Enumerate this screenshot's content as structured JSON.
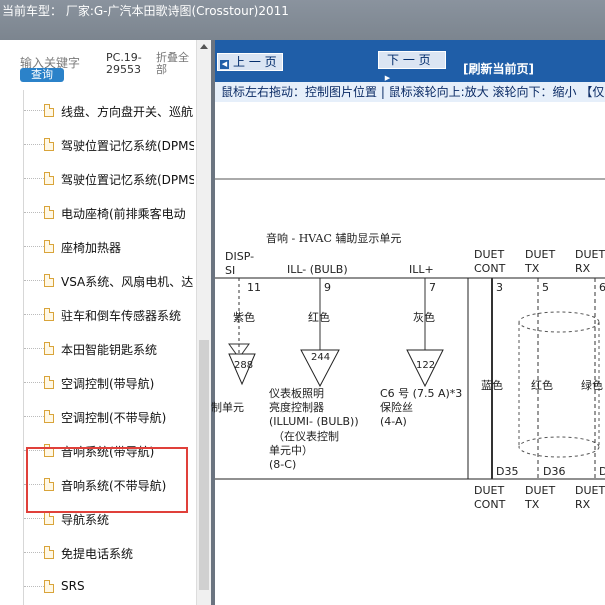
{
  "window": {
    "title": "当前车型：  厂家:G-广汽本田歌诗图(Crosstour)2011"
  },
  "left_panel": {
    "search_placeholder": "输入关键字",
    "query_button": "查询",
    "code": "PC.19-29553",
    "fold_all": "折叠全部",
    "items": [
      {
        "label": "线盘、方向盘开关、巡航"
      },
      {
        "label": "驾驶位置记忆系统(DPMS"
      },
      {
        "label": "驾驶位置记忆系统(DPMS"
      },
      {
        "label": "电动座椅(前排乘客电动"
      },
      {
        "label": "座椅加热器"
      },
      {
        "label": "VSA系统、风扇电机、达"
      },
      {
        "label": "驻车和倒车传感器系统"
      },
      {
        "label": "本田智能钥匙系统"
      },
      {
        "label": "空调控制(带导航)"
      },
      {
        "label": "空调控制(不带导航)"
      },
      {
        "label": "音响系统(带导航)"
      },
      {
        "label": "音响系统(不带导航)"
      },
      {
        "label": "导航系统"
      },
      {
        "label": "免提电话系统"
      },
      {
        "label": "SRS"
      }
    ]
  },
  "viewer": {
    "prev_button": "上 一 页",
    "next_button": "下 一 页",
    "refresh_link": "[刷新当前页]",
    "hint": "鼠标左右拖动：控制图片位置 | 鼠标滚轮向上:放大  滚轮向下：缩小 【仅",
    "diagram": {
      "unit_title": "音响 - HVAC 辅助显示单元",
      "pin_labels": [
        "DISP-",
        "SI",
        "ILL- (BULB)",
        "ILL+",
        "DUET",
        "CONT",
        "DUET",
        "TX",
        "DUET",
        "RX"
      ],
      "pin_numbers": [
        "11",
        "9",
        "7",
        "3",
        "5",
        "6"
      ],
      "wire_colors": [
        "紫色",
        "红色",
        "灰色",
        "蓝色",
        "红色",
        "绿色"
      ],
      "connectors": [
        "288",
        "244",
        "122"
      ],
      "left_unit": "制单元",
      "illum_text": [
        "仪表板照明",
        "亮度控制器",
        "(ILLUMI- (BULB))",
        "（在仪表控制",
        "单元中）",
        "(8-C)"
      ],
      "fuse_text": [
        "C6 号 (7.5 A)*3",
        "保险丝",
        "(4-A)"
      ],
      "bottom_codes": [
        "D35",
        "D36",
        "D"
      ],
      "bottom_labels": [
        "DUET",
        "CONT",
        "DUET",
        "TX",
        "DUET",
        "RX"
      ]
    }
  },
  "colors": {
    "toolbar": "#1f5ea8",
    "highlight": "#e0403a",
    "titlebar": "#8a939e"
  }
}
